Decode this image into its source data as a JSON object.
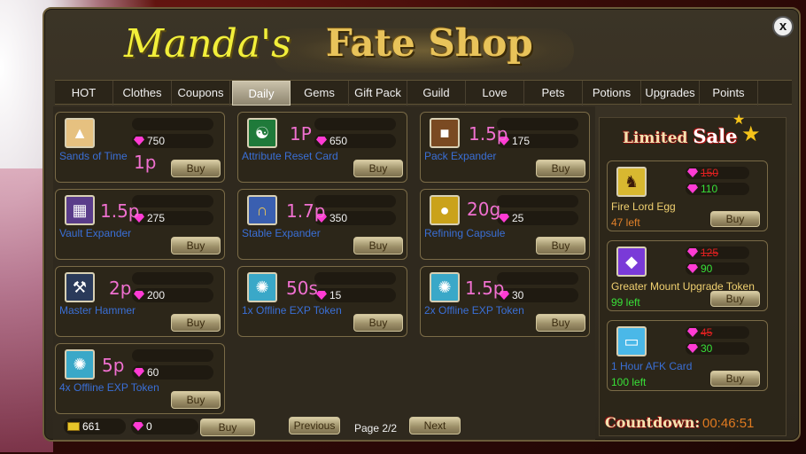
{
  "title": {
    "part1": "Manda's",
    "part2": "Fate Shop"
  },
  "close_label": "x",
  "tabs": [
    {
      "label": "HOT"
    },
    {
      "label": "Clothes"
    },
    {
      "label": "Coupons"
    },
    {
      "label": "Daily"
    },
    {
      "label": "Gems"
    },
    {
      "label": "Gift Pack"
    },
    {
      "label": "Guild"
    },
    {
      "label": "Love"
    },
    {
      "label": "Pets"
    },
    {
      "label": "Potions"
    },
    {
      "label": "Upgrades"
    },
    {
      "label": "Points"
    }
  ],
  "active_tab": "Daily",
  "items": [
    {
      "name": "Sands of Time",
      "price": "750",
      "note": "1p",
      "buy": "Buy",
      "icon": "hourglass-icon",
      "icon_color": "#e6c180"
    },
    {
      "name": "Attribute Reset Card",
      "price": "650",
      "note": "1P",
      "buy": "Buy",
      "icon": "yin-yang-icon",
      "icon_color": "#1f7a3a"
    },
    {
      "name": "Pack Expander",
      "price": "175",
      "note": "1.5p",
      "buy": "Buy",
      "icon": "backpack-icon",
      "icon_color": "#7a4a22"
    },
    {
      "name": "Vault Expander",
      "price": "275",
      "note": "1.5p",
      "buy": "Buy",
      "icon": "chest-icon",
      "icon_color": "#5a3c8a"
    },
    {
      "name": "Stable Expander",
      "price": "350",
      "note": "1.7p",
      "buy": "Buy",
      "icon": "horseshoe-icon",
      "icon_color": "#3a5fb0"
    },
    {
      "name": "Refining Capsule",
      "price": "25",
      "note": "20g",
      "buy": "Buy",
      "icon": "golden-orb-icon",
      "icon_color": "#caa21a"
    },
    {
      "name": "Master Hammer",
      "price": "200",
      "note": "2p",
      "buy": "Buy",
      "icon": "hammer-icon",
      "icon_color": "#2a3a5a"
    },
    {
      "name": "1x Offline EXP Token",
      "price": "15",
      "note": "50s",
      "buy": "Buy",
      "icon": "exp-token-icon",
      "icon_color": "#3aa8c8"
    },
    {
      "name": "2x Offline EXP Token",
      "price": "30",
      "note": "1.5p",
      "buy": "Buy",
      "icon": "exp-token-icon",
      "icon_color": "#3aa8c8"
    },
    {
      "name": "4x Offline EXP Token",
      "price": "60",
      "note": "5p",
      "buy": "Buy",
      "icon": "exp-token-icon",
      "icon_color": "#3aa8c8"
    }
  ],
  "footer": {
    "gold": "661",
    "gems": "0",
    "buy": "Buy",
    "previous": "Previous",
    "page": "Page 2/2",
    "next": "Next"
  },
  "limited_sale": {
    "title_part1": "Limited",
    "title_part2": "Sale",
    "items": [
      {
        "name": "Fire Lord Egg",
        "old_price": "150",
        "new_price": "110",
        "left": "47 left",
        "left_color": "#e0802a",
        "buy": "Buy",
        "icon": "fire-lord-egg-icon",
        "icon_color": "#d8b830"
      },
      {
        "name": "Greater Mount Upgrade Token",
        "old_price": "125",
        "new_price": "90",
        "left": "99 left",
        "left_color": "#38e038",
        "buy": "Buy",
        "icon": "mount-token-icon",
        "icon_color": "#7a3ad8"
      },
      {
        "name": "1 Hour AFK Card",
        "old_price": "45",
        "new_price": "30",
        "left": "100 left",
        "left_color": "#38e038",
        "buy": "Buy",
        "icon": "afk-card-icon",
        "icon_color": "#4ab8e8"
      }
    ],
    "countdown_label": "Countdown:",
    "countdown_value": "00:46:51"
  },
  "colors": {
    "gem": "#ff3bd4",
    "note": "#f070d0",
    "item_name": "#3a6fd6",
    "old_price": "#e02020",
    "new_price": "#38e038"
  }
}
